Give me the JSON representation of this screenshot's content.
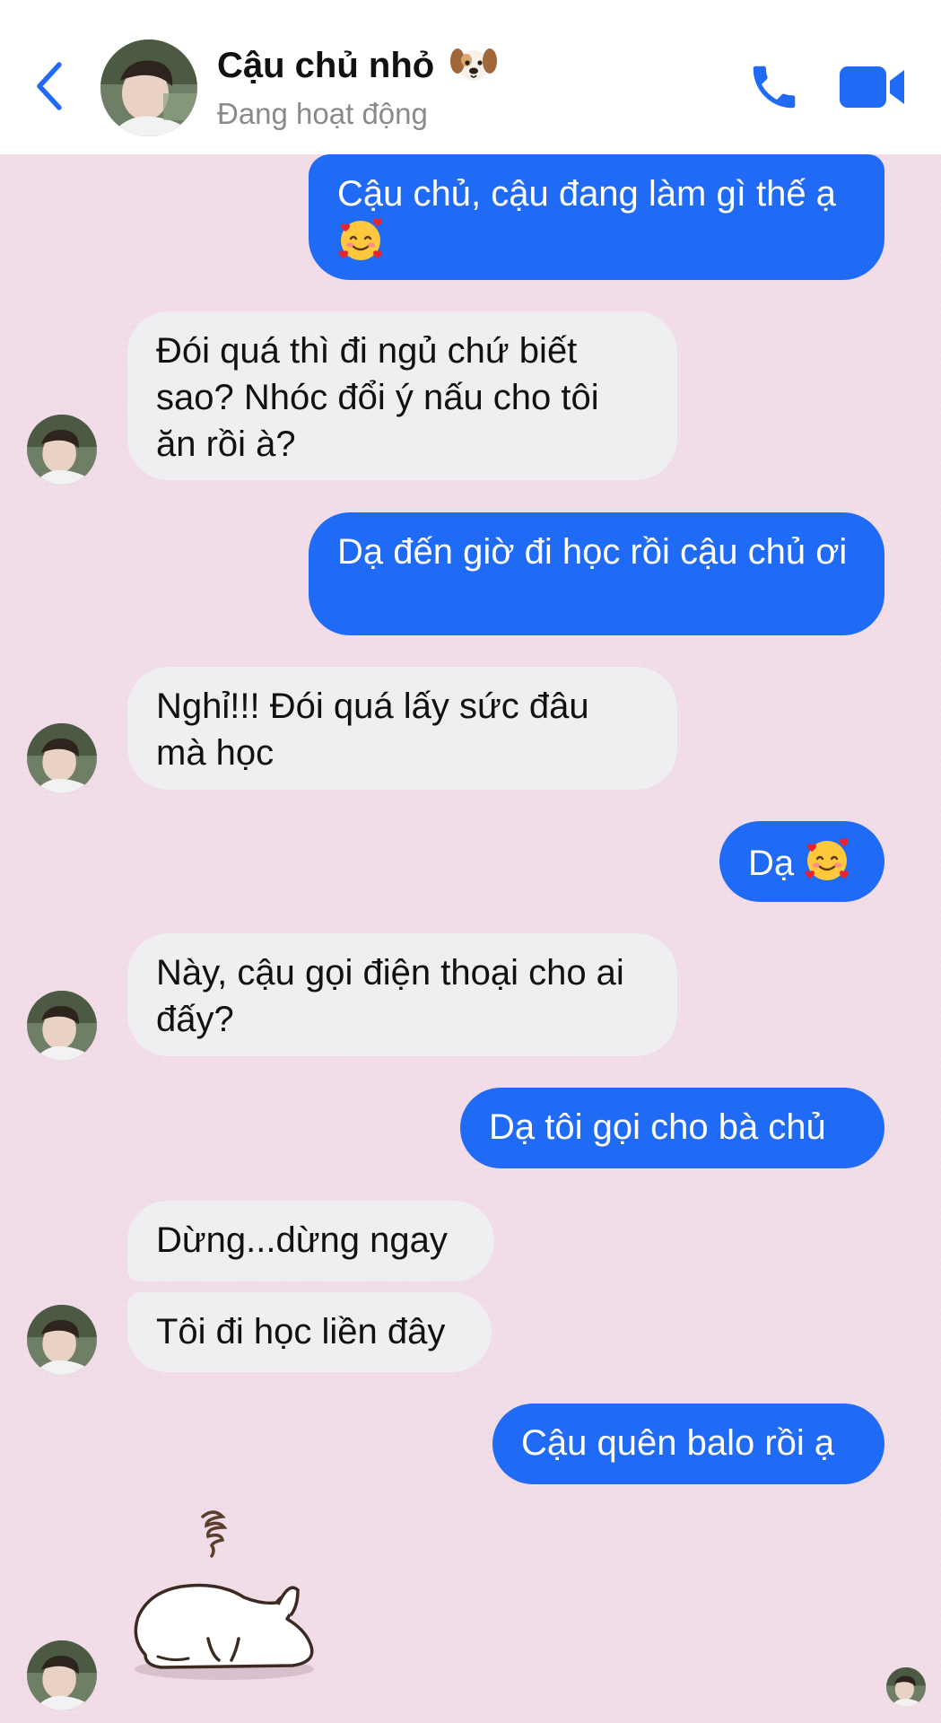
{
  "header": {
    "contact_name": "Cậu chủ nhỏ",
    "status": "Đang hoạt động"
  },
  "messages": [
    {
      "text": "Cậu chủ, cậu đang làm gì thế ạ",
      "emoji": "smiling-face-with-hearts"
    },
    {
      "text": "Đói quá thì đi ngủ chứ biết sao? Nhóc đổi ý nấu cho tôi ăn rồi à?"
    },
    {
      "text": "Dạ đến giờ đi học rồi cậu chủ ơi"
    },
    {
      "text": "Nghỉ!!! Đói quá lấy sức đâu mà học"
    },
    {
      "text": "Dạ",
      "emoji": "smiling-face-with-hearts"
    },
    {
      "text": "Này, cậu gọi điện thoại cho ai đấy?"
    },
    {
      "text": "Dạ tôi gọi cho bà chủ"
    },
    {
      "text": "Dừng...dừng ngay"
    },
    {
      "text": "Tôi đi học liền đây"
    },
    {
      "text": "Cậu quên balo rồi ạ"
    }
  ],
  "colors": {
    "accent": "#1f6bf5",
    "incoming_bubble": "#efeff1",
    "chat_background": "#f1dce8",
    "status_text": "#8a8a8a"
  },
  "icons": [
    "back-chevron-icon",
    "phone-icon",
    "video-camera-icon",
    "dog-face-emoji",
    "smiling-face-with-hearts-emoji",
    "sleeping-cat-sticker"
  ]
}
